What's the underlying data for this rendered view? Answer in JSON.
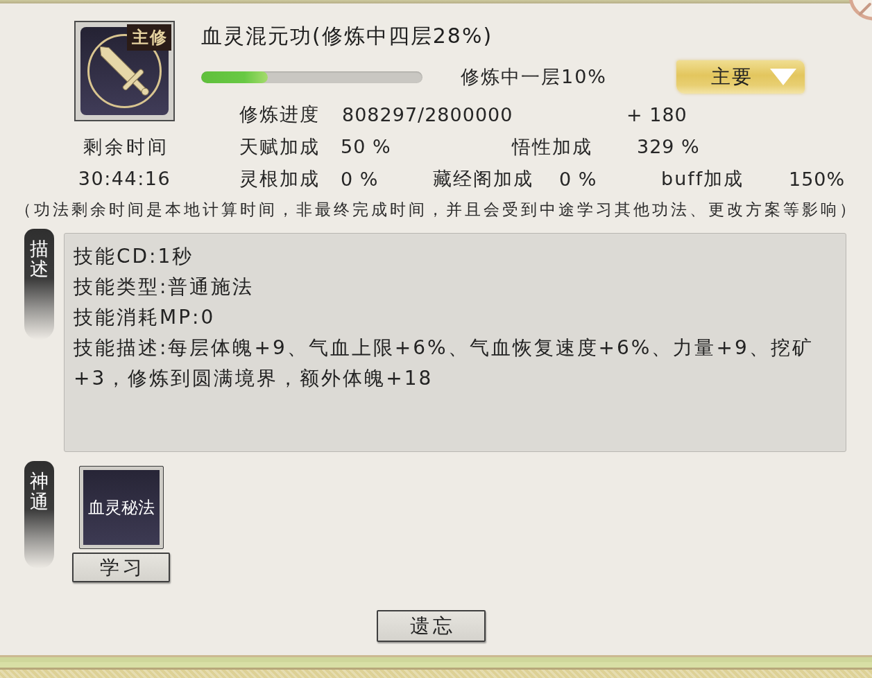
{
  "skill": {
    "badge": "主修",
    "title": "血灵混元功(修炼中四层28%)",
    "progress": {
      "level": 0.3
    },
    "stage": "修炼中一层10%",
    "category": {
      "value": "主要"
    }
  },
  "remaining_time": {
    "label": "剩余时间",
    "value": "30:44:16"
  },
  "cultivation_progress": {
    "label": "修炼进度",
    "value": "808297/2800000",
    "gain": "+ 180"
  },
  "bonus_rows": [
    {
      "items": [
        {
          "label": "天赋加成",
          "value": "50 %"
        },
        {
          "label": "悟性加成",
          "value": "329 %"
        }
      ]
    },
    {
      "items": [
        {
          "label": "灵根加成",
          "value": "0 %"
        },
        {
          "label": "藏经阁加成",
          "value": "0 %"
        },
        {
          "label": "buff加成",
          "value": "150%"
        }
      ]
    }
  ],
  "note": "（功法剩余时间是本地计算时间，非最终完成时间，并且会受到中途学习其他功法、更改方案等影响）",
  "description": {
    "tag": "描述",
    "lines": [
      "技能CD:1秒",
      "技能类型:普通施法",
      "技能消耗MP:0",
      "技能描述:每层体魄+9、气血上限+6%、气血恢复速度+6%、力量+9、挖矿+3，修炼到圆满境界，额外体魄+18"
    ]
  },
  "abilities": {
    "tag": "神通",
    "items": [
      {
        "name": "血灵秘法",
        "button": "学习"
      }
    ]
  },
  "forget_button": "遗忘"
}
